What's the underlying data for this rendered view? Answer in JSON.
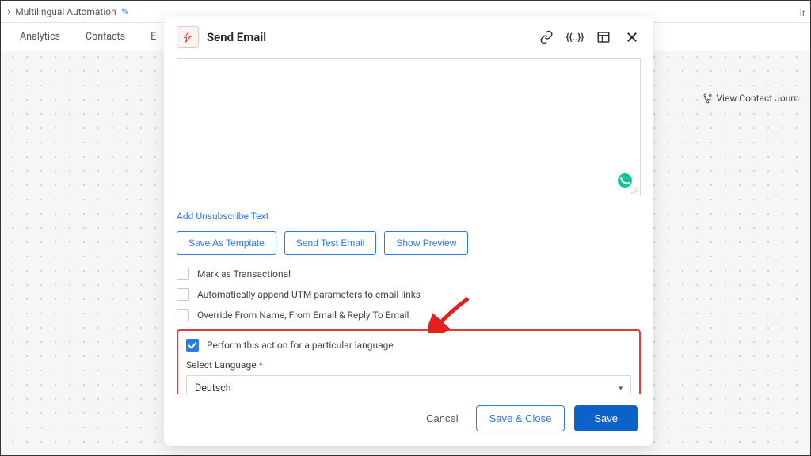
{
  "top": {
    "title": "Multilingual Automation"
  },
  "tabs": [
    "Analytics",
    "Contacts",
    "E"
  ],
  "right_link": "View Contact Journ",
  "top_right": "Ir",
  "modal": {
    "title": "Send Email",
    "add_unsub": "Add Unsubscribe Text",
    "buttons": {
      "save_tpl": "Save As Template",
      "send_test": "Send Test Email",
      "preview": "Show Preview"
    },
    "checks": {
      "transactional": "Mark as Transactional",
      "utm": "Automatically append UTM parameters to email links",
      "override": "Override From Name, From Email & Reply To Email",
      "lang_action": "Perform this action for a particular language"
    },
    "lang_label": "Select Language",
    "lang_value": "Deutsch",
    "footer": {
      "cancel": "Cancel",
      "save_close": "Save & Close",
      "save": "Save"
    }
  }
}
